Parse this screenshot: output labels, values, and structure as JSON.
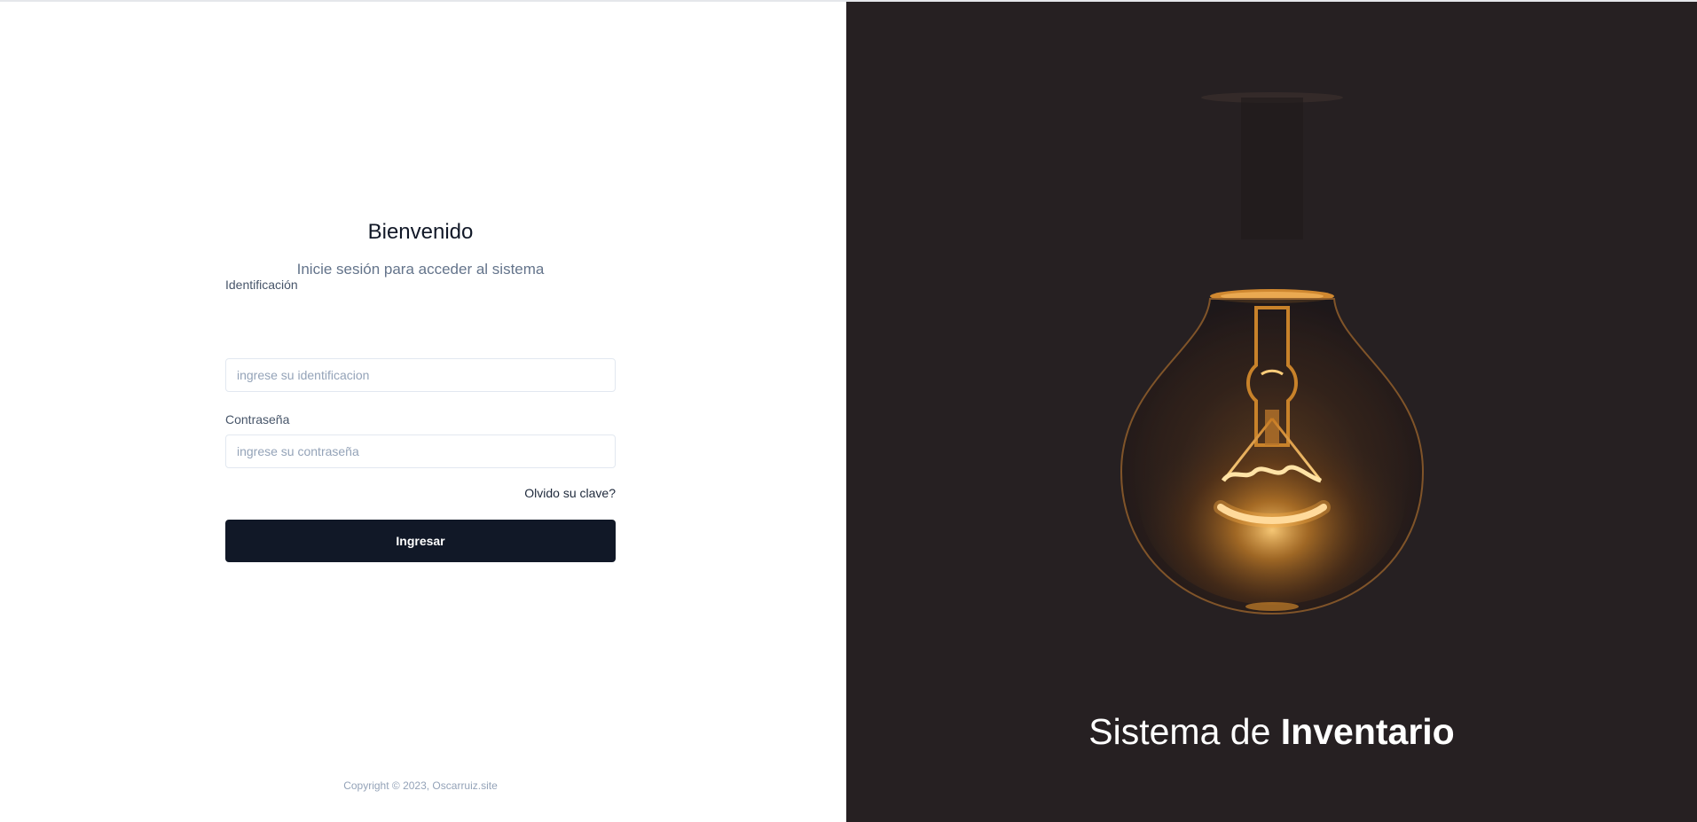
{
  "login": {
    "title": "Bienvenido",
    "subtitle": "Inicie sesión para acceder al sistema",
    "id_label": "Identificación",
    "id_placeholder": "ingrese su identificacion",
    "password_label": "Contraseña",
    "password_placeholder": "ingrese su contraseña",
    "forgot_link": "Olvido su clave?",
    "submit_label": "Ingresar",
    "copyright": "Copyright © 2023, Oscarruiz.site"
  },
  "hero": {
    "title_prefix": "Sistema de ",
    "title_bold": "Inventario",
    "image_icon": "light-bulb-illustration",
    "background_color": "#262022"
  },
  "colors": {
    "primary_button": "#111827",
    "text_muted": "#64748b"
  }
}
